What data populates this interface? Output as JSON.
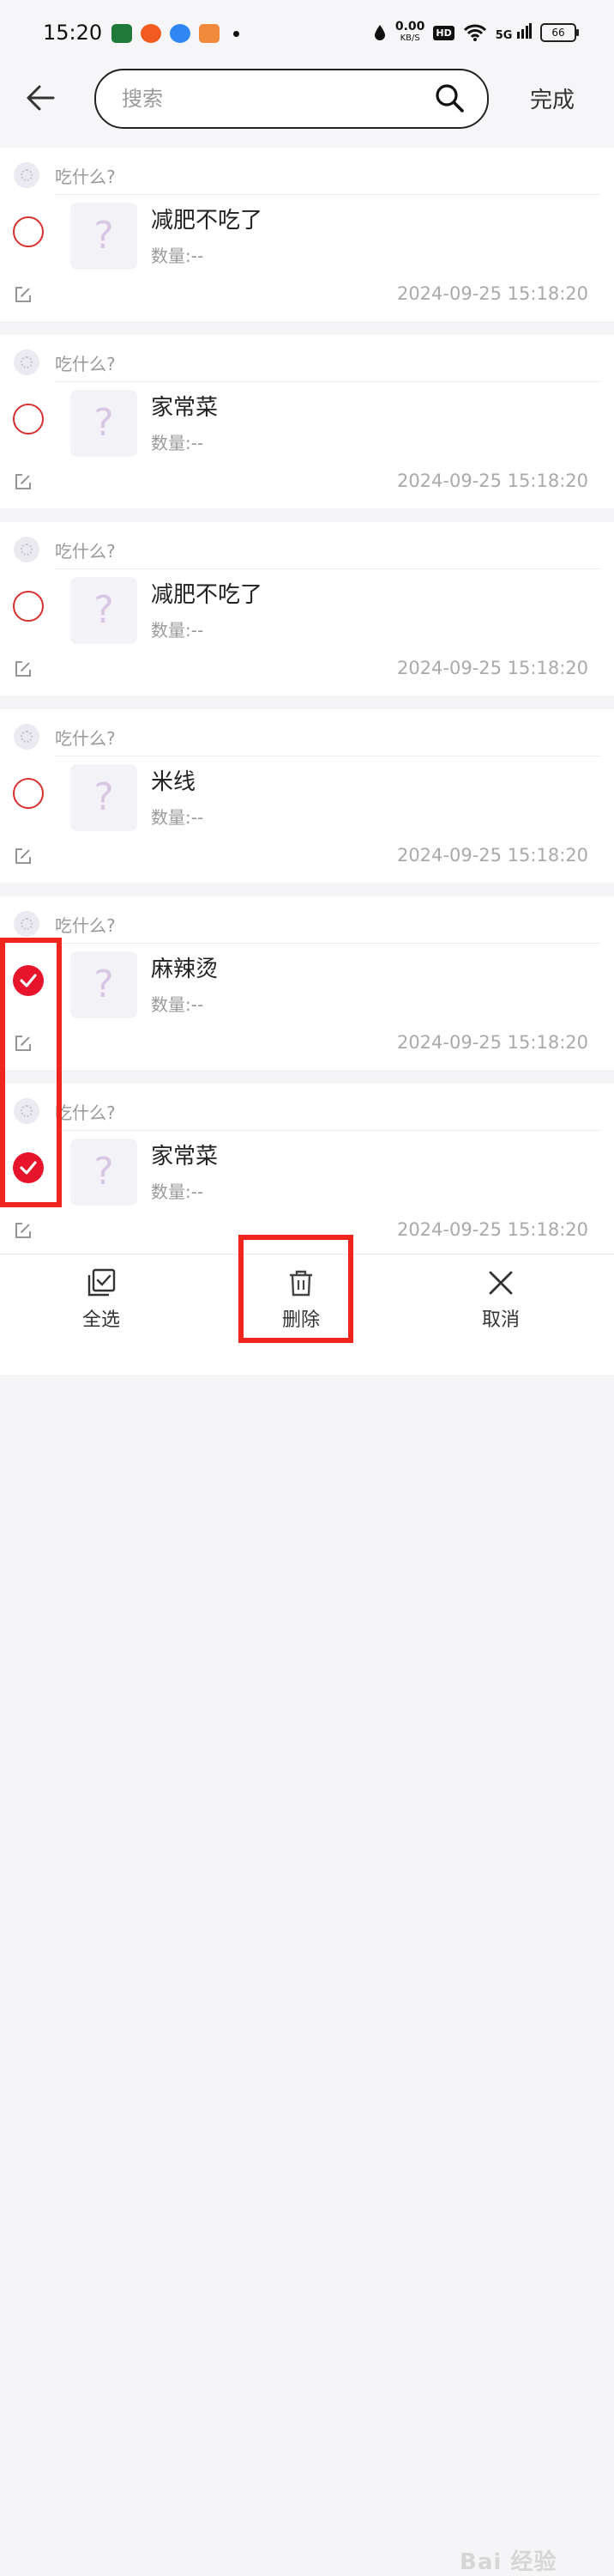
{
  "status_bar": {
    "time": "15:20",
    "net_speed": "0.00",
    "net_unit": "KB/S",
    "hd": "HD",
    "signal": "5G",
    "battery": "66"
  },
  "header": {
    "search_placeholder": "搜索",
    "done_label": "完成"
  },
  "items": [
    {
      "group": "吃什么?",
      "name": "减肥不吃了",
      "qty": "数量:--",
      "time": "2024-09-25 15:18:20",
      "checked": false
    },
    {
      "group": "吃什么?",
      "name": "家常菜",
      "qty": "数量:--",
      "time": "2024-09-25 15:18:20",
      "checked": false
    },
    {
      "group": "吃什么?",
      "name": "减肥不吃了",
      "qty": "数量:--",
      "time": "2024-09-25 15:18:20",
      "checked": false
    },
    {
      "group": "吃什么?",
      "name": "米线",
      "qty": "数量:--",
      "time": "2024-09-25 15:18:20",
      "checked": false
    },
    {
      "group": "吃什么?",
      "name": "麻辣烫",
      "qty": "数量:--",
      "time": "2024-09-25 15:18:20",
      "checked": true
    },
    {
      "group": "吃什么?",
      "name": "家常菜",
      "qty": "数量:--",
      "time": "2024-09-25 15:18:20",
      "checked": true
    }
  ],
  "thumb_placeholder": "?",
  "bottom_bar": {
    "select_all": "全选",
    "delete": "删除",
    "cancel": "取消"
  },
  "watermark": "Bai 经验",
  "colors": {
    "accent_red": "#e8142c",
    "highlight": "#f0261e"
  }
}
